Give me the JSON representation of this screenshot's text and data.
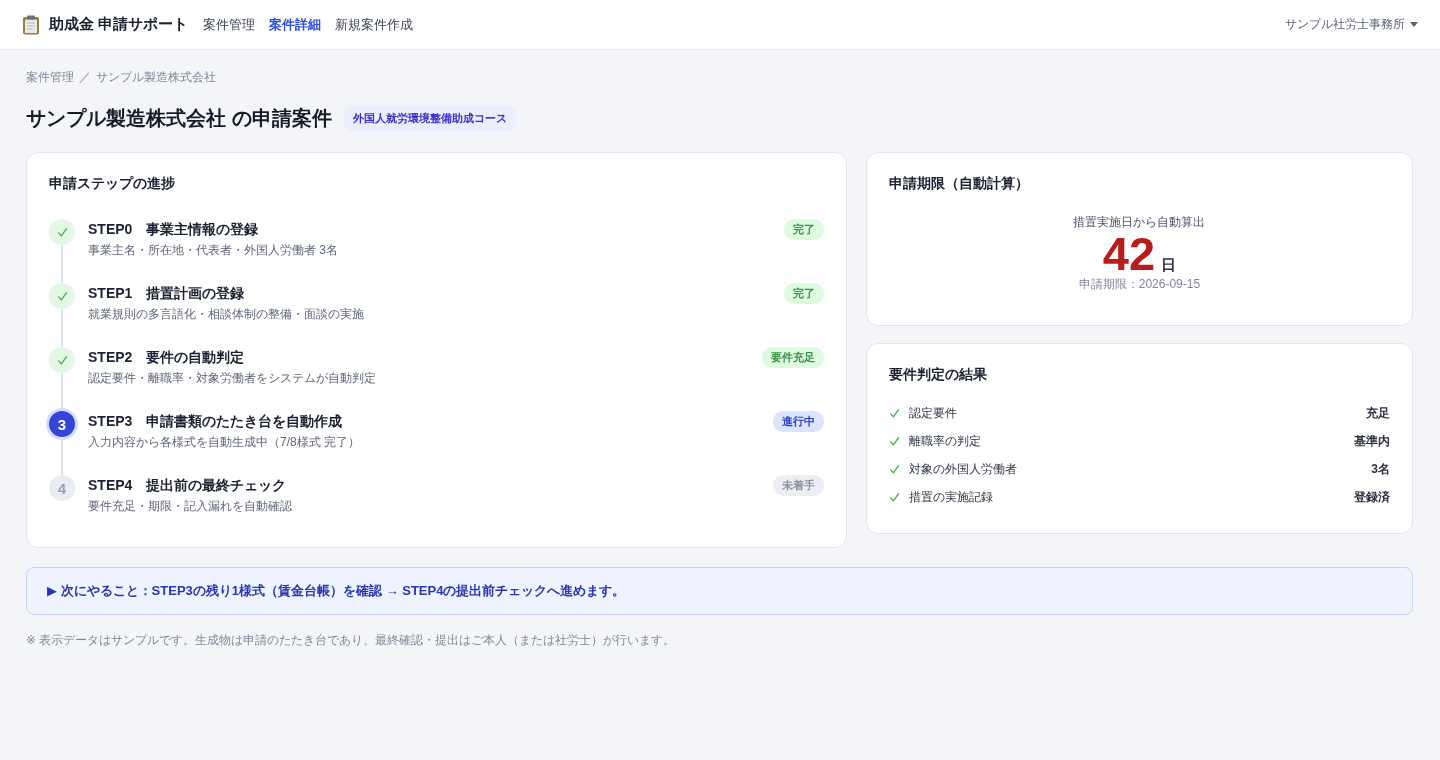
{
  "header": {
    "brand": "助成金 申請サポート",
    "nav": [
      {
        "label": "案件管理",
        "selected": false
      },
      {
        "label": "案件詳細",
        "selected": true
      },
      {
        "label": "新規案件作成",
        "selected": false
      }
    ],
    "account": "サンプル社労士事務所"
  },
  "breadcrumb": {
    "items": [
      "案件管理",
      "サンプル製造株式会社"
    ],
    "separator": "／"
  },
  "page": {
    "title": "サンプル製造株式会社 の申請案件",
    "course_tag": "外国人就労環境整備助成コース"
  },
  "steps_card": {
    "title": "申請ステップの進捗",
    "steps": [
      {
        "kind": "done",
        "title": "STEP0　事業主情報の登録",
        "description": "事業主名・所在地・代表者・外国人労働者 3名",
        "badge": "完了"
      },
      {
        "kind": "done",
        "title": "STEP1　措置計画の登録",
        "description": "就業規則の多言語化・相談体制の整備・面談の実施",
        "badge": "完了"
      },
      {
        "kind": "done",
        "title": "STEP2　要件の自動判定",
        "description": "認定要件・離職率・対象労働者をシステムが自動判定",
        "badge": "要件充足"
      },
      {
        "kind": "active",
        "marker": "3",
        "title": "STEP3　申請書類のたたき台を自動作成",
        "description": "入力内容から各様式を自動生成中（7/8様式 完了）",
        "badge": "進行中"
      },
      {
        "kind": "todo",
        "marker": "4",
        "title": "STEP4　提出前の最終チェック",
        "description": "要件充足・期限・記入漏れを自動確認",
        "badge": "未着手"
      }
    ]
  },
  "deadline_card": {
    "title": "申請期限（自動計算）",
    "caption": "措置実施日から自動算出",
    "days": "42",
    "unit": "日",
    "due": "申請期限：2026-09-15"
  },
  "results_card": {
    "title": "要件判定の結果",
    "rows": [
      {
        "label": "認定要件",
        "value": "充足",
        "passed": true
      },
      {
        "label": "離職率の判定",
        "value": "基準内",
        "passed": true
      },
      {
        "label": "対象の外国人労働者",
        "value": "3名",
        "passed": true
      },
      {
        "label": "措置の実施記録",
        "value": "登録済",
        "passed": true
      }
    ]
  },
  "next_action": {
    "text": "▶ 次にやること：STEP3の残り1様式（賃金台帳）を確認 → STEP4の提出前チェックへ進めます。"
  },
  "footnote": "※ 表示データはサンプルです。生成物は申請のたたき台であり、最終確認・提出はご本人（または社労士）が行います。"
}
